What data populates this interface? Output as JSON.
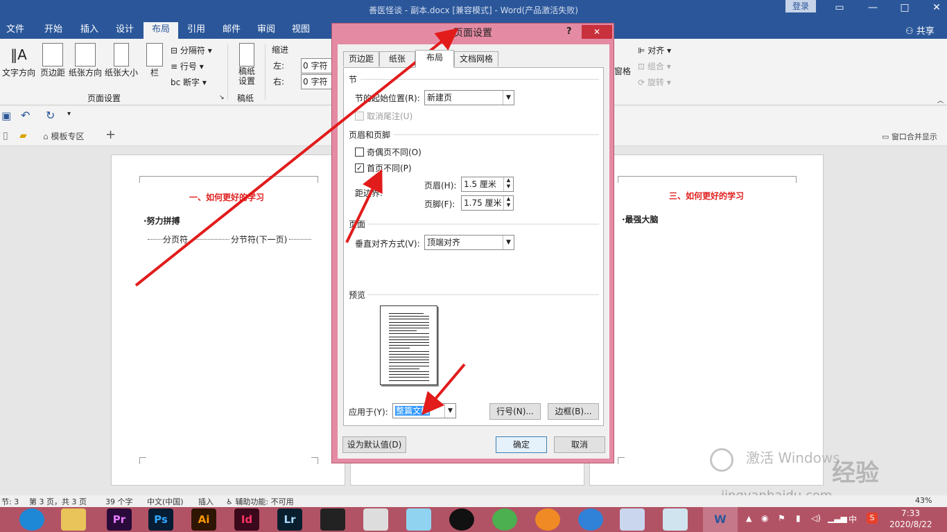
{
  "window": {
    "title": "善医怪谈 - 副本.docx [兼容模式] - Word(产品激活失败)",
    "login": "登录"
  },
  "ribbon_tabs": [
    "文件",
    "开始",
    "插入",
    "设计",
    "布局",
    "引用",
    "邮件",
    "审阅",
    "视图"
  ],
  "share": "共享",
  "ribbon": {
    "text_direction": "文字方向",
    "margins": "页边距",
    "orientation": "纸张方向",
    "size": "纸张大小",
    "columns": "栏",
    "breaks": "分隔符",
    "line_numbers": "行号",
    "hyphenation": "断字",
    "page_setup_group": "页面设置",
    "manuscript": "稿纸\n设置",
    "manuscript_group": "稿纸",
    "indent": "缩进",
    "indent_left_label": "左:",
    "indent_left": "0 字符",
    "indent_right_label": "右:",
    "indent_right": "0 字符",
    "align": "对齐",
    "group": "组合",
    "rotate": "旋转",
    "pane": "窗格"
  },
  "tabbar": {
    "templates": "模板专区",
    "merge_windows": "窗口合并显示"
  },
  "pages": {
    "p1_heading": "一、如何更好的学习",
    "p1_body": "·努力拼搏",
    "p1_break_page": "分页符",
    "p1_break_section": "分节符(下一页)",
    "p3_heading": "三、如何更好的学习",
    "p3_body": "·最强大脑"
  },
  "dialog": {
    "title": "页面设置",
    "help": "?",
    "tabs": [
      "页边距",
      "纸张",
      "布局",
      "文档网格"
    ],
    "section_label": "节",
    "section_start_label": "节的起始位置(R):",
    "section_start_value": "新建页",
    "suppress_endnotes": "取消尾注(U)",
    "header_footer_label": "页眉和页脚",
    "odd_even": "奇偶页不同(O)",
    "first_page": "首页不同(P)",
    "from_edge": "距边界:",
    "header_label": "页眉(H):",
    "header_value": "1.5 厘米",
    "footer_label": "页脚(F):",
    "footer_value": "1.75 厘米",
    "page_label": "页面",
    "valign_label": "垂直对齐方式(V):",
    "valign_value": "顶端对齐",
    "preview_label": "预览",
    "apply_to_label": "应用于(Y):",
    "apply_to_value": "整篇文档",
    "line_numbers_btn": "行号(N)...",
    "borders_btn": "边框(B)...",
    "set_default_btn": "设为默认值(D)",
    "ok_btn": "确定",
    "cancel_btn": "取消"
  },
  "status": {
    "section": "节: 3",
    "page": "第 3 页，共 3 页",
    "words": "39 个字",
    "language": "中文(中国)",
    "mode": "插入",
    "accessibility": "辅助功能: 不可用",
    "zoom": "43%"
  },
  "taskbar": {
    "time": "7:33",
    "date": "2020/8/22",
    "ime": "中"
  },
  "watermark": {
    "activate": "激活 Windows",
    "site": "jingyanbaidu.com",
    "brand": "经验"
  },
  "colors": {
    "word_blue": "#2b579a",
    "dialog_frame": "#e58aa3",
    "annotation_red": "#e21b1b",
    "heading_red": "#e02020"
  }
}
